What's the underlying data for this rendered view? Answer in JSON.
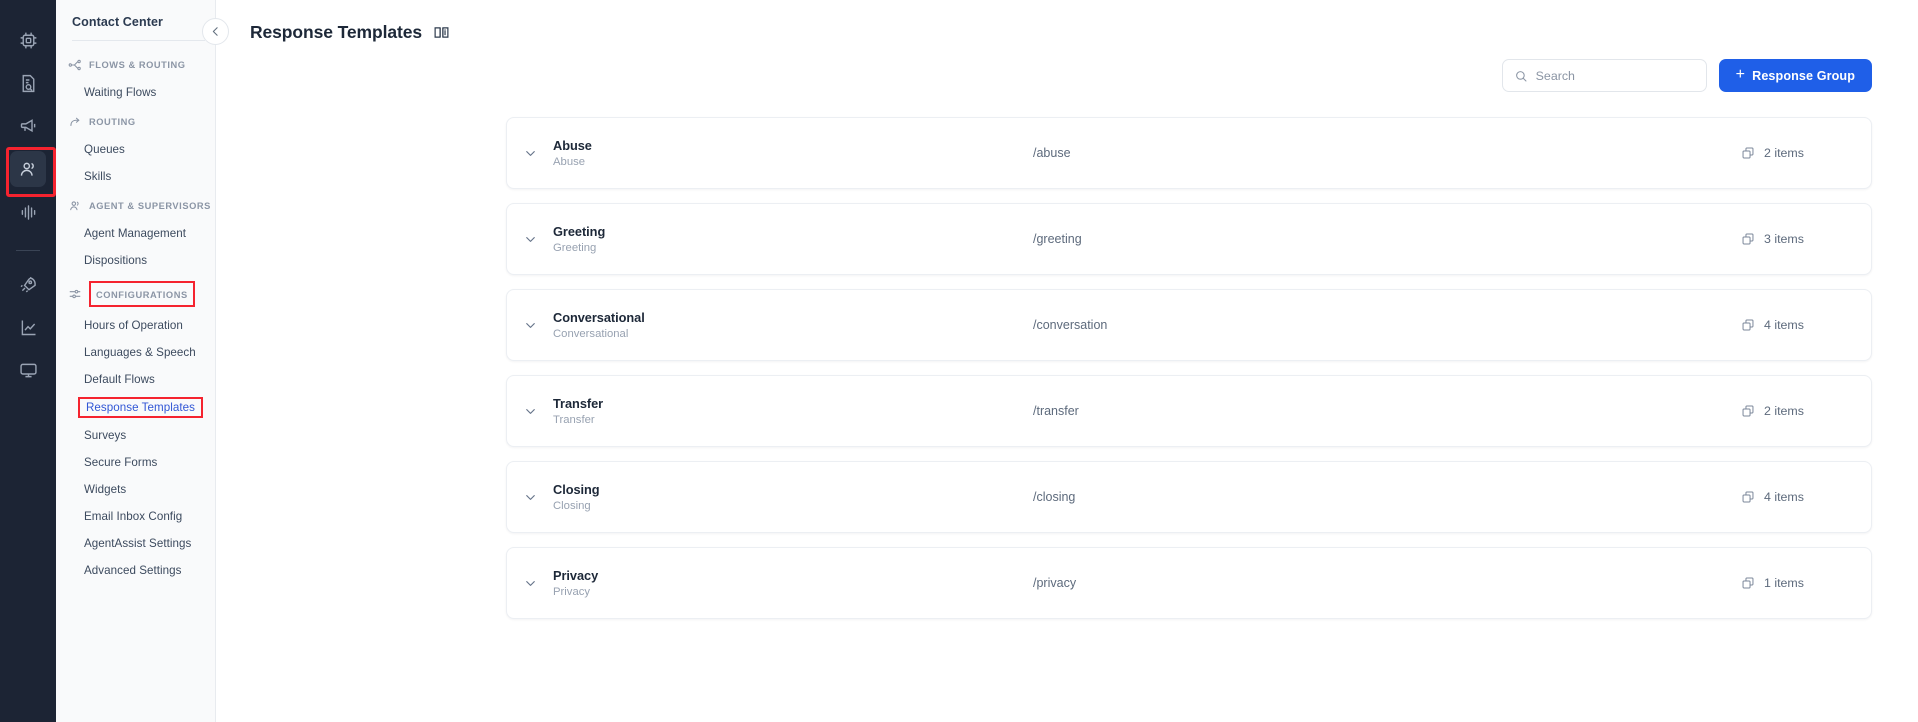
{
  "rail": {
    "items": [
      {
        "icon": "chip-icon",
        "name": "rail-item-ai",
        "active": false,
        "highlight": false
      },
      {
        "icon": "document-search-icon",
        "name": "rail-item-knowledge",
        "active": false,
        "highlight": false
      },
      {
        "icon": "megaphone-icon",
        "name": "rail-item-campaigns",
        "active": false,
        "highlight": false
      },
      {
        "icon": "people-icon",
        "name": "rail-item-contact-center",
        "active": true,
        "highlight": true
      },
      {
        "icon": "waveform-icon",
        "name": "rail-item-voice",
        "active": false,
        "highlight": false
      },
      {
        "icon": "rocket-icon",
        "name": "rail-item-deploy",
        "active": false,
        "highlight": false
      },
      {
        "icon": "chart-line-icon",
        "name": "rail-item-analytics",
        "active": false,
        "highlight": false
      },
      {
        "icon": "monitor-icon",
        "name": "rail-item-monitor",
        "active": false,
        "highlight": false
      }
    ]
  },
  "sidebar": {
    "title": "Contact Center",
    "groups": [
      {
        "label": "FLOWS & ROUTING",
        "icon": "flow-nodes-icon",
        "highlighted": false,
        "items": [
          {
            "label": "Waiting Flows",
            "selected": false
          }
        ]
      },
      {
        "label": "ROUTING",
        "icon": "arrow-redirect-icon",
        "highlighted": false,
        "items": [
          {
            "label": "Queues",
            "selected": false
          },
          {
            "label": "Skills",
            "selected": false
          }
        ]
      },
      {
        "label": "AGENT & SUPERVISORS",
        "icon": "user-group-icon",
        "highlighted": false,
        "items": [
          {
            "label": "Agent Management",
            "selected": false
          },
          {
            "label": "Dispositions",
            "selected": false
          }
        ]
      },
      {
        "label": "CONFIGURATIONS",
        "icon": "sliders-icon",
        "highlighted": true,
        "items": [
          {
            "label": "Hours of Operation",
            "selected": false
          },
          {
            "label": "Languages & Speech",
            "selected": false
          },
          {
            "label": "Default Flows",
            "selected": false
          },
          {
            "label": "Response Templates",
            "selected": true
          },
          {
            "label": "Surveys",
            "selected": false
          },
          {
            "label": "Secure Forms",
            "selected": false
          },
          {
            "label": "Widgets",
            "selected": false
          },
          {
            "label": "Email Inbox Config",
            "selected": false
          },
          {
            "label": "AgentAssist Settings",
            "selected": false
          },
          {
            "label": "Advanced Settings",
            "selected": false
          }
        ]
      }
    ]
  },
  "header": {
    "title": "Response Templates",
    "book_icon": "open-book-icon",
    "collapse_icon": "chevron-left-icon"
  },
  "toolbar": {
    "search_placeholder": "Search",
    "search_value": "",
    "search_icon": "search-icon",
    "add_button_label": "Response Group",
    "add_button_plus": "+"
  },
  "colors": {
    "accent": "#1f5fe8",
    "rail_bg": "#1c2434",
    "sidebar_bg": "#f9fafb",
    "highlight_outline": "#f5232f",
    "selected_link": "#3257d6"
  },
  "groups_list": [
    {
      "name": "Abuse",
      "description": "Abuse",
      "path": "/abuse",
      "items_count": "2 items",
      "chevron": "chevron-down-icon",
      "items_icon": "copy-stack-icon"
    },
    {
      "name": "Greeting",
      "description": "Greeting",
      "path": "/greeting",
      "items_count": "3 items",
      "chevron": "chevron-down-icon",
      "items_icon": "copy-stack-icon"
    },
    {
      "name": "Conversational",
      "description": "Conversational",
      "path": "/conversation",
      "items_count": "4 items",
      "chevron": "chevron-down-icon",
      "items_icon": "copy-stack-icon"
    },
    {
      "name": "Transfer",
      "description": "Transfer",
      "path": "/transfer",
      "items_count": "2 items",
      "chevron": "chevron-down-icon",
      "items_icon": "copy-stack-icon"
    },
    {
      "name": "Closing",
      "description": "Closing",
      "path": "/closing",
      "items_count": "4 items",
      "chevron": "chevron-down-icon",
      "items_icon": "copy-stack-icon"
    },
    {
      "name": "Privacy",
      "description": "Privacy",
      "path": "/privacy",
      "items_count": "1 items",
      "chevron": "chevron-down-icon",
      "items_icon": "copy-stack-icon"
    }
  ]
}
